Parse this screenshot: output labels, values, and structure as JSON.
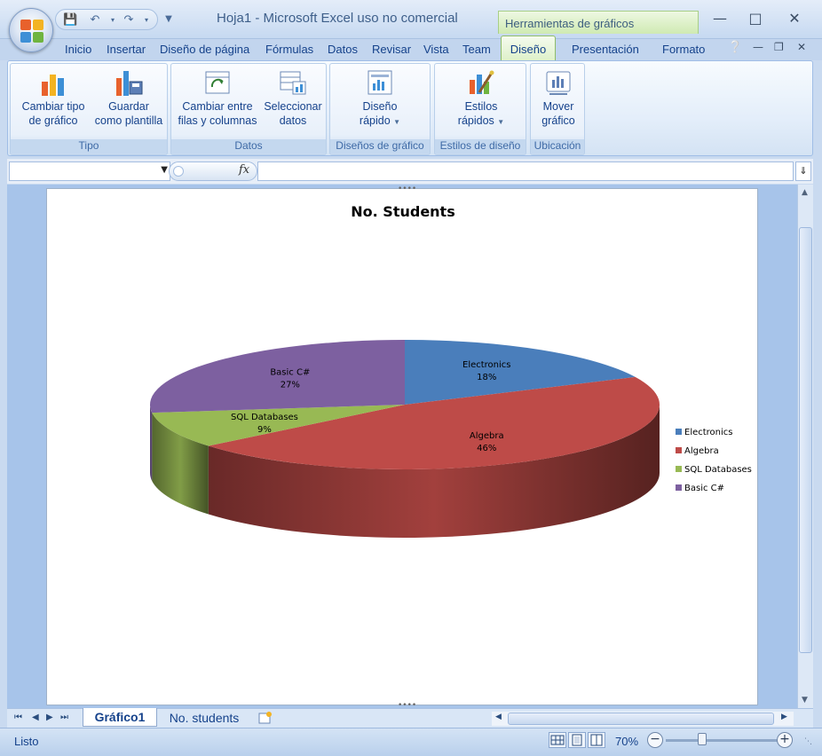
{
  "window": {
    "title": "Hoja1 - Microsoft Excel uso no comercial",
    "contextual_tools": "Herramientas de gráficos"
  },
  "menu_tabs": [
    "Inicio",
    "Insertar",
    "Diseño de página",
    "Fórmulas",
    "Datos",
    "Revisar",
    "Vista",
    "Team",
    "Diseño",
    "Presentación",
    "Formato"
  ],
  "ribbon": {
    "groups": [
      {
        "label": "Tipo",
        "buttons": [
          {
            "line1": "Cambiar tipo",
            "line2": "de gráfico"
          },
          {
            "line1": "Guardar",
            "line2": "como plantilla"
          }
        ]
      },
      {
        "label": "Datos",
        "buttons": [
          {
            "line1": "Cambiar entre",
            "line2": "filas y columnas"
          },
          {
            "line1": "Seleccionar",
            "line2": "datos"
          }
        ]
      },
      {
        "label": "Diseños de gráfico",
        "buttons": [
          {
            "line1": "Diseño",
            "line2": "rápido"
          }
        ]
      },
      {
        "label": "Estilos de diseño",
        "buttons": [
          {
            "line1": "Estilos",
            "line2": "rápidos"
          }
        ]
      },
      {
        "label": "Ubicación",
        "buttons": [
          {
            "line1": "Mover",
            "line2": "gráfico"
          }
        ]
      }
    ]
  },
  "formula_bar": {
    "name_box": "",
    "fx_label": "fx",
    "formula": ""
  },
  "chart_data": {
    "type": "pie",
    "style": "3d-exploded-none",
    "title": "No. Students",
    "categories": [
      "Electronics",
      "Algebra",
      "SQL Databases",
      "Basic C#"
    ],
    "values": [
      18,
      46,
      9,
      27
    ],
    "labels": [
      "18%",
      "46%",
      "9%",
      "27%"
    ],
    "colors": [
      "#4a7ebb",
      "#be4b48",
      "#98b954",
      "#7d60a0"
    ],
    "legend_position": "right"
  },
  "sheets": {
    "active": "Gráfico1",
    "others": [
      "No. students"
    ]
  },
  "status": {
    "text": "Listo",
    "zoom": "70%",
    "zoom_level": 70
  },
  "colors": {
    "ribbon_bg": "#dfe9f5",
    "contextual_green": "#cfeab2",
    "text": "#15428b"
  }
}
